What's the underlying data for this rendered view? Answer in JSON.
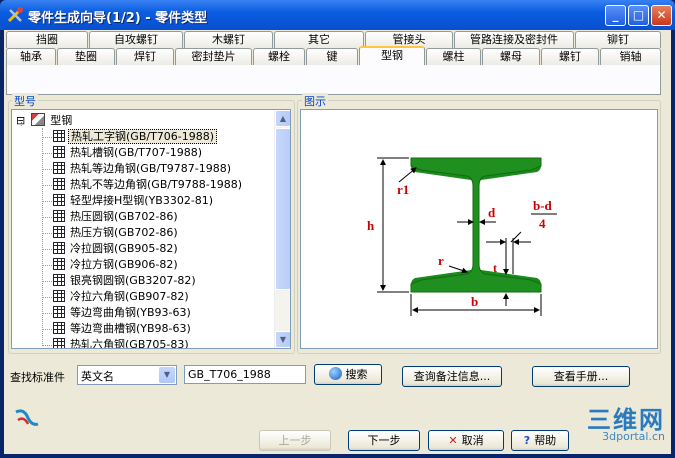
{
  "window": {
    "title": "零件生成向导(1/2) - 零件类型",
    "minimize": "_",
    "maximize": "□",
    "close": "✕"
  },
  "tabs_row1": [
    "挡圈",
    "自攻螺钉",
    "木螺钉",
    "其它",
    "管接头",
    "管路连接及密封件",
    "铆钉"
  ],
  "tabs_row2": [
    "轴承",
    "垫圈",
    "焊钉",
    "密封垫片",
    "螺栓",
    "键",
    "型钢",
    "螺柱",
    "螺母",
    "螺钉",
    "销轴"
  ],
  "active_tab": "型钢",
  "groups": {
    "type_label": "型号",
    "preview_label": "图示"
  },
  "tree": {
    "expander": "⊟",
    "root_label": "型钢",
    "items": [
      "热轧工字钢(GB/T706-1988)",
      "热轧槽钢(GB/T707-1988)",
      "热轧等边角钢(GB/T9787-1988)",
      "热轧不等边角钢(GB/T9788-1988)",
      "轻型焊接H型钢(YB3302-81)",
      "热压圆钢(GB702-86)",
      "热压方钢(GB702-86)",
      "冷拉圆钢(GB905-82)",
      "冷拉方钢(GB906-82)",
      "银亮钢圆钢(GB3207-82)",
      "冷拉六角钢(GB907-82)",
      "等边弯曲角钢(YB93-63)",
      "等边弯曲槽钢(YB98-63)",
      "热轧六角钢(GB705-83)"
    ],
    "selected_index": 0
  },
  "diagram": {
    "labels": {
      "r1": "r1",
      "h": "h",
      "d": "d",
      "bd_num": "b-d",
      "bd_den": "4",
      "r": "r",
      "t": "t",
      "b": "b"
    },
    "colors": {
      "steel": "#1a8a1a",
      "dim": "#cc0000",
      "line": "#000000"
    }
  },
  "search": {
    "label": "查找标准件",
    "mode": "英文名",
    "value": "GB_T706_1988",
    "search_btn": "搜索",
    "query_btn": "查询备注信息...",
    "manual_btn": "查看手册..."
  },
  "footer": {
    "prev": "上一步",
    "next": "下一步",
    "cancel": "取消",
    "help": "帮助",
    "cancel_icon": "✕",
    "help_icon": "?"
  },
  "brand": {
    "name": "三维网",
    "url": "3dportal.cn"
  },
  "colors": {
    "accent": "#0046d5",
    "titlebar": "#0a5de0",
    "face": "#ece9d8"
  }
}
